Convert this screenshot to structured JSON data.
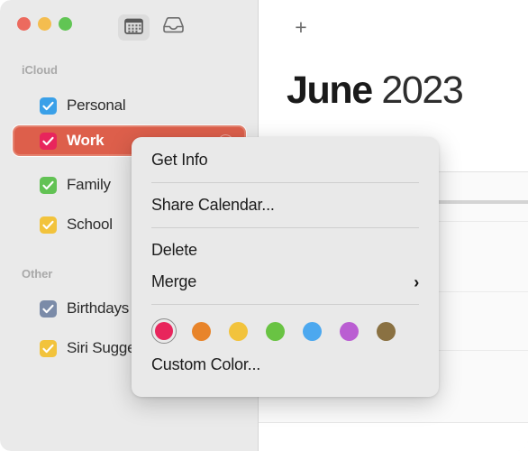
{
  "window": {
    "traffic_lights": [
      {
        "name": "close",
        "color": "#ec6a5e"
      },
      {
        "name": "minimize",
        "color": "#f4bd4f"
      },
      {
        "name": "maximize",
        "color": "#61c554"
      }
    ]
  },
  "toolbar": {
    "buttons": [
      {
        "icon": "calendar-icon",
        "label": "Calendar",
        "active": true
      },
      {
        "icon": "inbox-icon",
        "label": "Inbox",
        "active": false
      }
    ],
    "add_label": "+"
  },
  "sidebar": {
    "sections": [
      {
        "title": "iCloud",
        "items": [
          {
            "label": "Personal",
            "color": "#3aa0e8",
            "checked": true,
            "selected": false
          },
          {
            "label": "Work",
            "color": "#e8255c",
            "checked": true,
            "selected": true
          },
          {
            "label": "Family",
            "color": "#62c254",
            "checked": true,
            "selected": false
          },
          {
            "label": "School",
            "color": "#f2c33c",
            "checked": true,
            "selected": false
          }
        ]
      },
      {
        "title": "Other",
        "items": [
          {
            "label": "Birthdays",
            "color": "#7b8ba8",
            "checked": true,
            "selected": false
          },
          {
            "label": "Siri Suggestions",
            "color": "#f2c33c",
            "checked": true,
            "selected": false
          }
        ]
      }
    ]
  },
  "main": {
    "month": "June",
    "year": "2023"
  },
  "context_menu": {
    "items": [
      {
        "label": "Get Info",
        "submenu": false
      },
      {
        "label": "Share Calendar...",
        "submenu": false
      },
      {
        "label": "Delete",
        "submenu": false
      },
      {
        "label": "Merge",
        "submenu": true,
        "chevron": "›"
      }
    ],
    "colors": [
      {
        "name": "red",
        "hex": "#e8255c",
        "selected": true
      },
      {
        "name": "orange",
        "hex": "#e8842a",
        "selected": false
      },
      {
        "name": "yellow",
        "hex": "#f2c33c",
        "selected": false
      },
      {
        "name": "green",
        "hex": "#69c343",
        "selected": false
      },
      {
        "name": "blue",
        "hex": "#4ca8ef",
        "selected": false
      },
      {
        "name": "purple",
        "hex": "#ba5ed2",
        "selected": false
      },
      {
        "name": "brown",
        "hex": "#8a7142",
        "selected": false
      }
    ],
    "custom_color_label": "Custom Color..."
  }
}
